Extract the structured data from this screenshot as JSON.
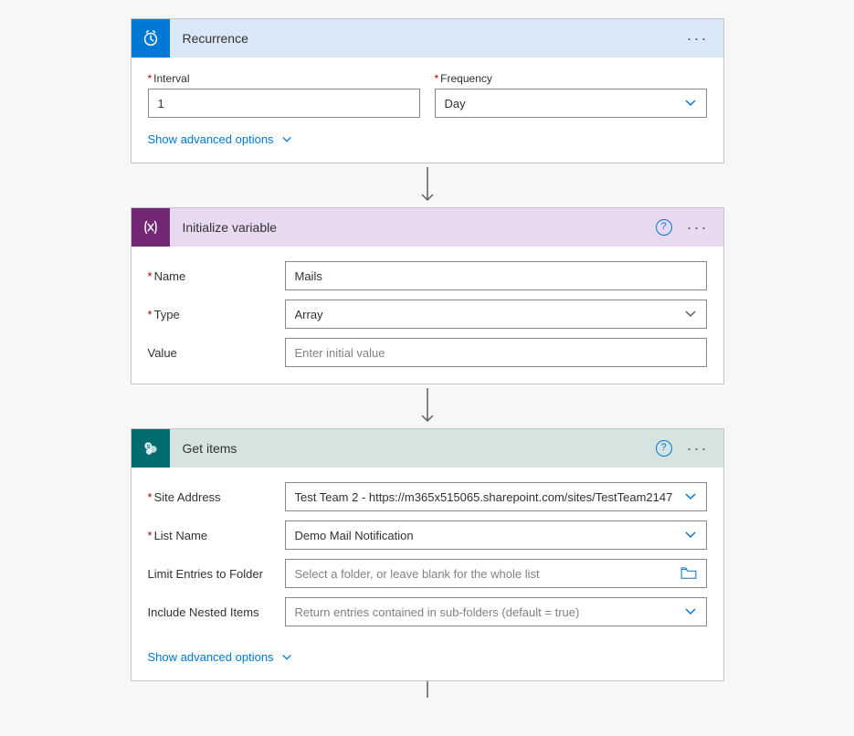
{
  "recurrence": {
    "title": "Recurrence",
    "interval_label": "Interval",
    "interval_value": "1",
    "frequency_label": "Frequency",
    "frequency_value": "Day",
    "advanced": "Show advanced options"
  },
  "initvar": {
    "title": "Initialize variable",
    "name_label": "Name",
    "name_value": "Mails",
    "type_label": "Type",
    "type_value": "Array",
    "value_label": "Value",
    "value_placeholder": "Enter initial value",
    "help": "?"
  },
  "getitems": {
    "title": "Get items",
    "site_label": "Site Address",
    "site_value": "Test Team 2 - https://m365x515065.sharepoint.com/sites/TestTeam2147",
    "list_label": "List Name",
    "list_value": "Demo Mail Notification",
    "limit_label": "Limit Entries to Folder",
    "limit_placeholder": "Select a folder, or leave blank for the whole list",
    "nested_label": "Include Nested Items",
    "nested_placeholder": "Return entries contained in sub-folders (default = true)",
    "advanced": "Show advanced options",
    "help": "?"
  }
}
